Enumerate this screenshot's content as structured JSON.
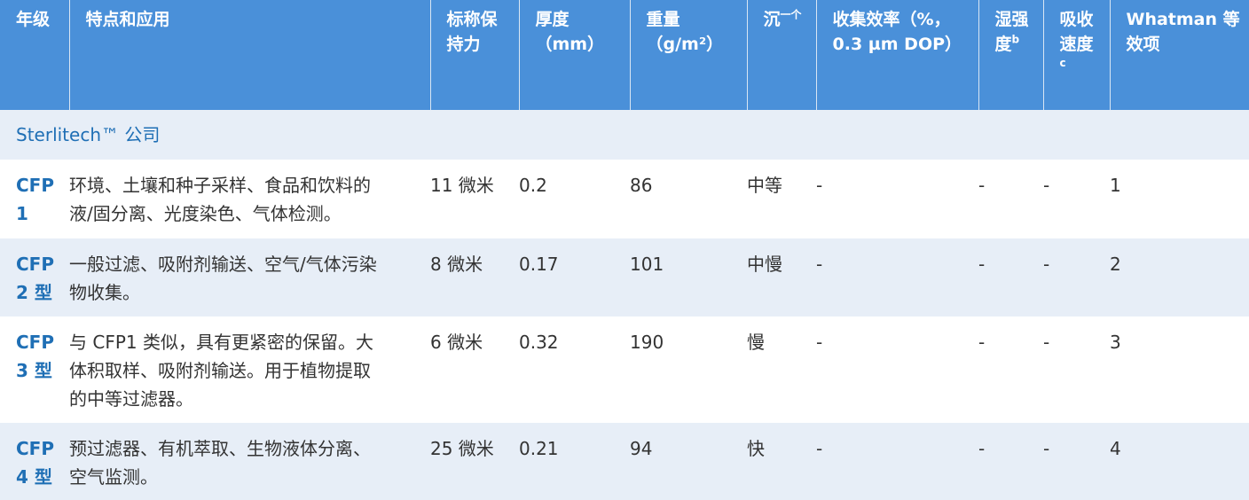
{
  "headers": {
    "grade": "年级",
    "features": "特点和应用",
    "retention_1": "标称保",
    "retention_2": "持力",
    "thickness_1": "厚度",
    "thickness_2": "（mm）",
    "weight_1": "重量",
    "weight_2": "（g/m²）",
    "flow": "沉",
    "flow_sup": "一个",
    "efficiency_1": "收集效率（%，",
    "efficiency_2": "0.3 µm DOP）",
    "wet_1": "湿强",
    "wet_2": "度",
    "wet_sup": "b",
    "absorb_1": "吸收",
    "absorb_2": "速度",
    "absorb_sub": "c",
    "whatman_1": "Whatman 等",
    "whatman_2": "效项"
  },
  "section_label": "Sterlitech™ 公司",
  "rows": [
    {
      "grade_1": "CFP",
      "grade_2": "1",
      "use_1": "环境、土壤和种子采样、食品和饮料的",
      "use_2": "液/固分离、光度染色、气体检测。",
      "use_3": "",
      "retention": "11 微米",
      "thickness": "0.2",
      "weight": "86",
      "flow": "中等",
      "efficiency": "-",
      "wet": "-",
      "absorb": "-",
      "whatman": "1"
    },
    {
      "grade_1": "CFP",
      "grade_2": "2 型",
      "use_1": "一般过滤、吸附剂输送、空气/气体污染",
      "use_2": "物收集。",
      "use_3": "",
      "retention": "8 微米",
      "thickness": "0.17",
      "weight": "101",
      "flow": "中慢",
      "efficiency": "-",
      "wet": "-",
      "absorb": "-",
      "whatman": "2"
    },
    {
      "grade_1": "CFP",
      "grade_2": "3 型",
      "use_1": "与 CFP1 类似，具有更紧密的保留。大",
      "use_2": "体积取样、吸附剂输送。用于植物提取",
      "use_3": "的中等过滤器。",
      "retention": "6 微米",
      "thickness": "0.32",
      "weight": "190",
      "flow": "慢",
      "efficiency": "-",
      "wet": "-",
      "absorb": "-",
      "whatman": "3"
    },
    {
      "grade_1": "CFP",
      "grade_2": "4 型",
      "use_1": "预过滤器、有机萃取、生物液体分离、",
      "use_2": "空气监测。",
      "use_3": "",
      "retention": "25 微米",
      "thickness": "0.21",
      "weight": "94",
      "flow": "快",
      "efficiency": "-",
      "wet": "-",
      "absorb": "-",
      "whatman": "4"
    }
  ]
}
